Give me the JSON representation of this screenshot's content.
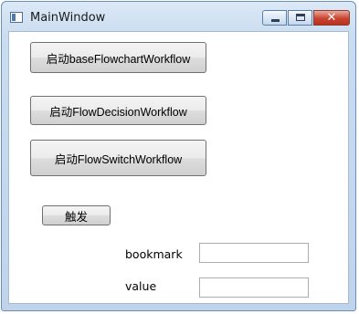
{
  "window": {
    "title": "MainWindow"
  },
  "buttons": {
    "base_flowchart": "启动baseFlowchartWorkflow",
    "flow_decision": "启动FlowDecisionWorkflow",
    "flow_switch": "启动FlowSwitchWorkflow",
    "trigger": "触发"
  },
  "fields": {
    "bookmark": {
      "label": "bookmark",
      "value": ""
    },
    "value": {
      "label": "value",
      "value": ""
    }
  }
}
